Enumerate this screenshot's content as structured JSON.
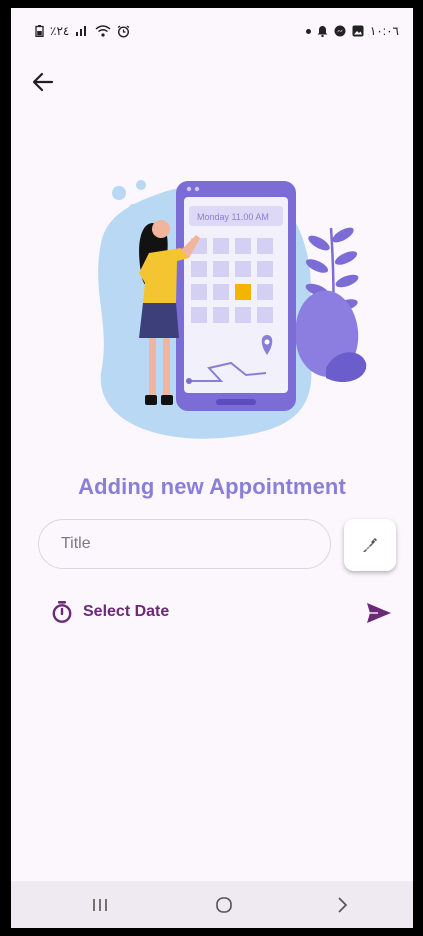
{
  "status_bar": {
    "left_text": "٪٢٤",
    "time": "١٠:٠٦"
  },
  "icons": {
    "back": "arrow-left-icon",
    "pick": "eyedropper-icon",
    "timer": "timer-icon",
    "send": "send-icon"
  },
  "heading": "Adding new Appointment",
  "illustration": {
    "phone_text": "Monday 11.00 AM"
  },
  "title_field": {
    "placeholder": "Title",
    "value": ""
  },
  "date_row": {
    "label": "Select Date"
  },
  "colors": {
    "accent": "#8a7fd6",
    "primary_dark": "#6a2a78",
    "background": "#fcf6fd"
  }
}
